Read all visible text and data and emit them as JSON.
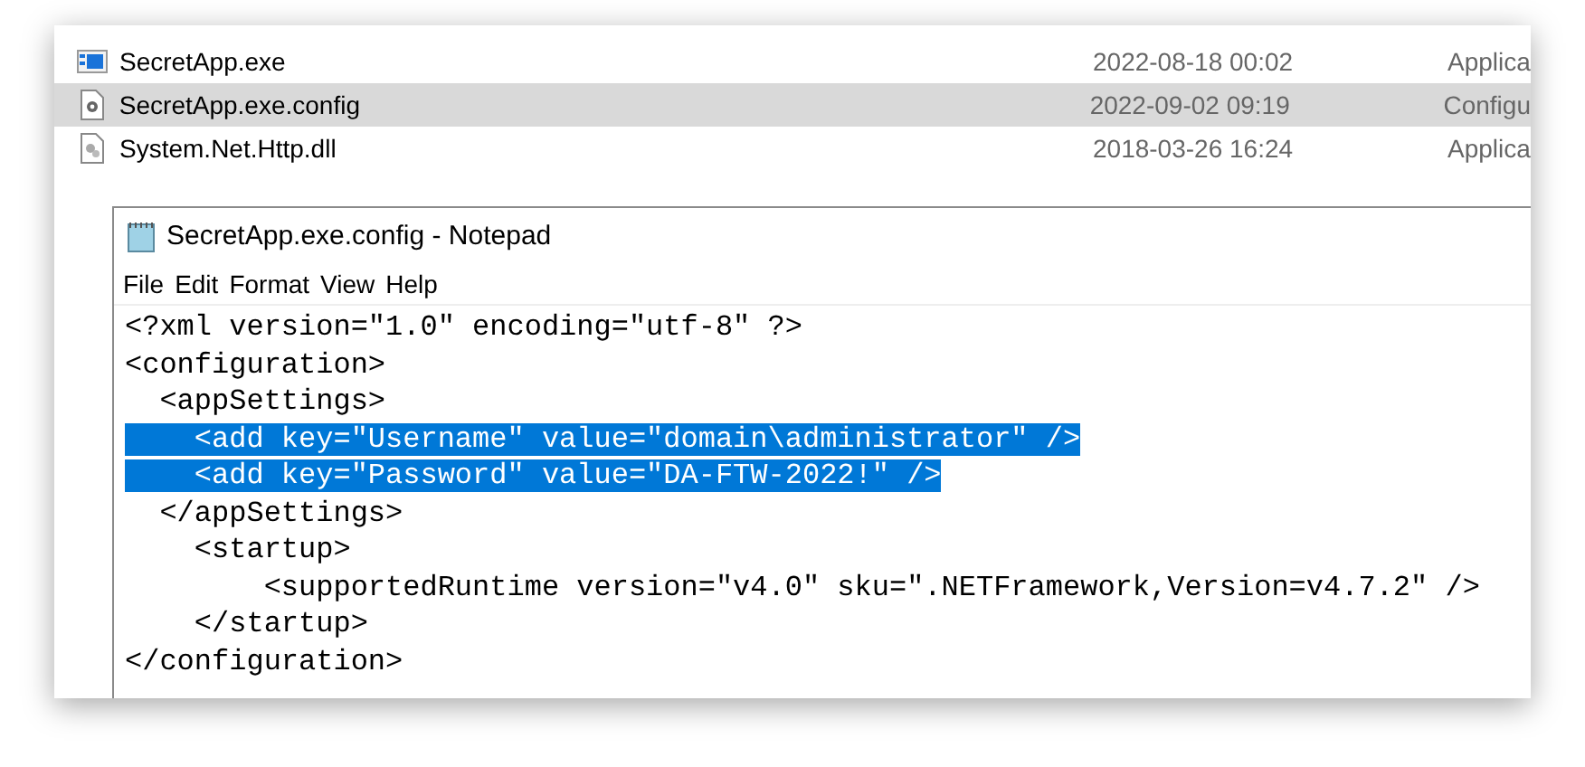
{
  "explorer": {
    "files": [
      {
        "name": "SecretApp.exe",
        "kind": "exe",
        "date": "2022-08-18 00:02",
        "type": "Applica",
        "selected": false
      },
      {
        "name": "SecretApp.exe.config",
        "kind": "config",
        "date": "2022-09-02 09:19",
        "type": "Configu",
        "selected": true
      },
      {
        "name": "System.Net.Http.dll",
        "kind": "dll",
        "date": "2018-03-26 16:24",
        "type": "Applica",
        "selected": false
      }
    ]
  },
  "notepad": {
    "title": "SecretApp.exe.config - Notepad",
    "menu": [
      "File",
      "Edit",
      "Format",
      "View",
      "Help"
    ],
    "lines": [
      {
        "text": "<?xml version=\"1.0\" encoding=\"utf-8\" ?>",
        "selected": false
      },
      {
        "text": "<configuration>",
        "selected": false
      },
      {
        "text": "  <appSettings>",
        "selected": false
      },
      {
        "text": "    <add key=\"Username\" value=\"domain\\administrator\" />",
        "selected": true
      },
      {
        "text": "    <add key=\"Password\" value=\"DA-FTW-2022!\" />",
        "selected": true
      },
      {
        "text": "  </appSettings>",
        "selected": false
      },
      {
        "text": "    <startup>",
        "selected": false
      },
      {
        "text": "        <supportedRuntime version=\"v4.0\" sku=\".NETFramework,Version=v4.7.2\" />",
        "selected": false
      },
      {
        "text": "    </startup>",
        "selected": false
      },
      {
        "text": "</configuration>",
        "selected": false
      }
    ]
  }
}
